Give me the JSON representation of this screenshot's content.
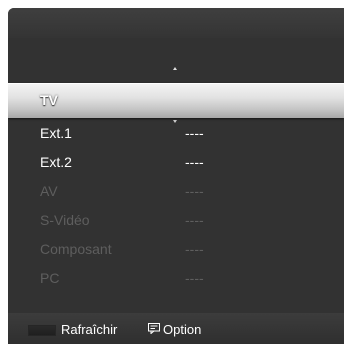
{
  "menu": {
    "items": [
      {
        "name": "TV",
        "value": "",
        "state": "selected"
      },
      {
        "name": "Ext.1",
        "value": "----",
        "state": "enabled"
      },
      {
        "name": "Ext.2",
        "value": "----",
        "state": "enabled"
      },
      {
        "name": "AV",
        "value": "----",
        "state": "disabled"
      },
      {
        "name": "S-Vidéo",
        "value": "----",
        "state": "disabled"
      },
      {
        "name": "Composant",
        "value": "----",
        "state": "disabled"
      },
      {
        "name": "PC",
        "value": "----",
        "state": "disabled"
      }
    ]
  },
  "footer": {
    "refresh_label": "Rafraîchir",
    "option_label": "Option",
    "refresh_key_icon": "red-color-key-icon",
    "option_icon": "tools-menu-icon"
  },
  "colors": {
    "background": "#323232",
    "text": "#ffffff",
    "disabled_text": "#5e5e5e",
    "highlight": "#d8d8d8"
  }
}
